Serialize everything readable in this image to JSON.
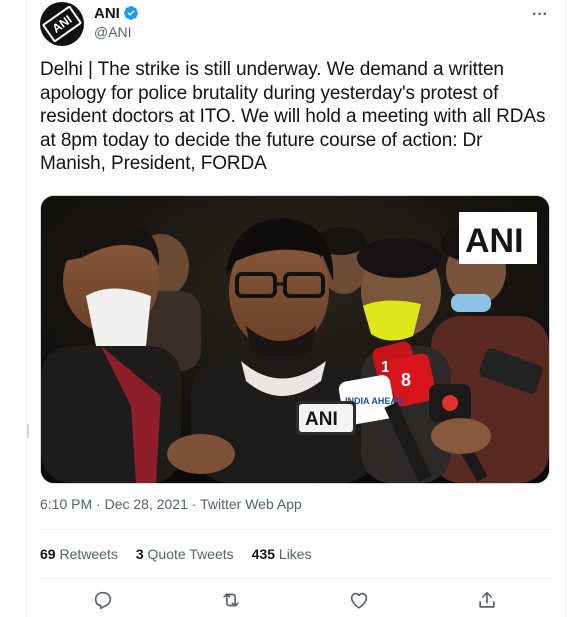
{
  "tweet": {
    "display_name": "ANI",
    "handle": "@ANI",
    "avatar_text": "ANI",
    "more_icon": "more-icon",
    "text": "Delhi | The strike is still underway. We demand a written apology for police brutality during yesterday's protest of resident doctors at ITO. We will hold a meeting with all RDAs at 8pm today to decide the future course of action: Dr Manish, President, FORDA",
    "media_watermark": "ANI",
    "mic_labels": {
      "ani": "ANI",
      "india_ahead": "INDIA AHEAD",
      "news18": "18",
      "ch8": "8"
    },
    "time": "6:10 PM",
    "date": "Dec 28, 2021",
    "source": "Twitter Web App",
    "separator": "·"
  },
  "stats": {
    "retweets_count": "69",
    "retweets_label": "Retweets",
    "quotes_count": "3",
    "quotes_label": "Quote Tweets",
    "likes_count": "435",
    "likes_label": "Likes"
  },
  "colors": {
    "verified": "#1d9bf0",
    "text_primary": "#0f1419",
    "text_secondary": "#536471",
    "border": "#eff3f4"
  },
  "actions": [
    "reply-icon",
    "retweet-icon",
    "like-icon",
    "share-icon"
  ]
}
